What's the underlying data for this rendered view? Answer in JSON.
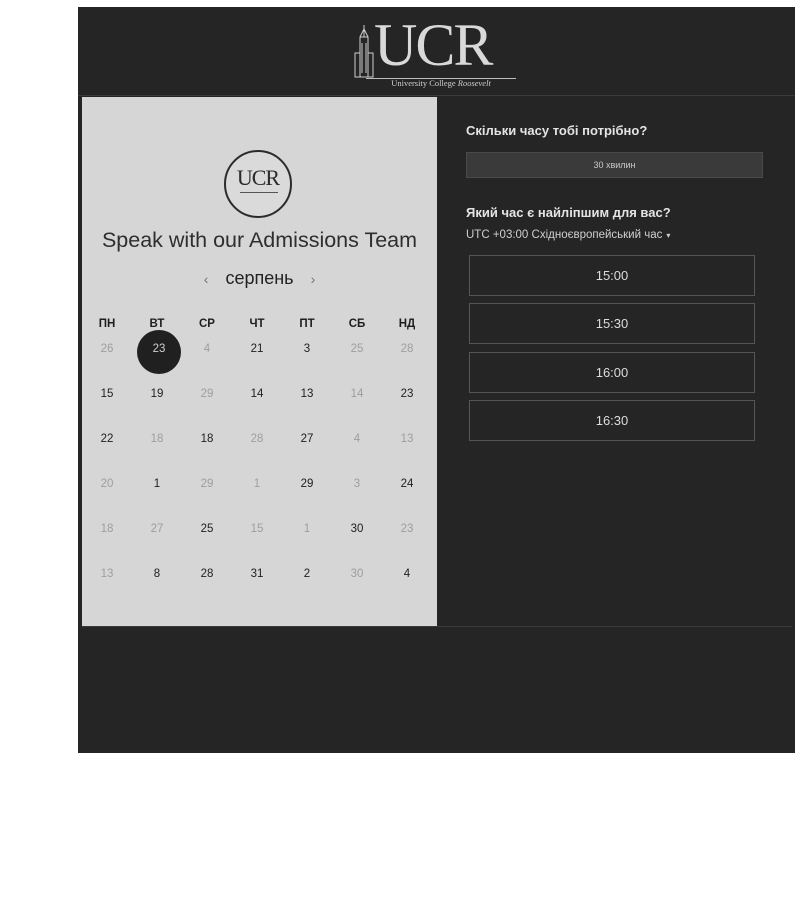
{
  "header": {
    "logo_text": "UCR",
    "logo_subtitle_main": "University College ",
    "logo_subtitle_italic": "Roosevelt"
  },
  "left": {
    "badge_text": "UCR",
    "title": "Speak with our Admissions Team",
    "month": "серпень",
    "prev_icon": "‹",
    "next_icon": "›",
    "weekdays": [
      "ПН",
      "ВТ",
      "СР",
      "ЧТ",
      "ПТ",
      "СБ",
      "НД"
    ],
    "selected_day": "23",
    "weeks": [
      [
        {
          "d": "26",
          "dim": true
        },
        {
          "d": "",
          "dim": false
        },
        {
          "d": "4",
          "dim": true
        },
        {
          "d": "21",
          "dim": false
        },
        {
          "d": "3",
          "dim": false
        },
        {
          "d": "25",
          "dim": true
        },
        {
          "d": "28",
          "dim": true
        }
      ],
      [
        {
          "d": "15",
          "dim": false
        },
        {
          "d": "19",
          "dim": false
        },
        {
          "d": "29",
          "dim": true
        },
        {
          "d": "14",
          "dim": false
        },
        {
          "d": "13",
          "dim": false
        },
        {
          "d": "14",
          "dim": true
        },
        {
          "d": "23",
          "dim": false
        }
      ],
      [
        {
          "d": "22",
          "dim": false
        },
        {
          "d": "18",
          "dim": true
        },
        {
          "d": "18",
          "dim": false
        },
        {
          "d": "28",
          "dim": true
        },
        {
          "d": "27",
          "dim": false
        },
        {
          "d": "4",
          "dim": true
        },
        {
          "d": "13",
          "dim": true
        }
      ],
      [
        {
          "d": "20",
          "dim": true
        },
        {
          "d": "1",
          "dim": false
        },
        {
          "d": "29",
          "dim": true
        },
        {
          "d": "1",
          "dim": true
        },
        {
          "d": "29",
          "dim": false
        },
        {
          "d": "3",
          "dim": true
        },
        {
          "d": "24",
          "dim": false
        }
      ],
      [
        {
          "d": "18",
          "dim": true
        },
        {
          "d": "27",
          "dim": true
        },
        {
          "d": "25",
          "dim": false
        },
        {
          "d": "15",
          "dim": true
        },
        {
          "d": "1",
          "dim": true
        },
        {
          "d": "30",
          "dim": false
        },
        {
          "d": "23",
          "dim": true
        }
      ],
      [
        {
          "d": "13",
          "dim": true
        },
        {
          "d": "8",
          "dim": false
        },
        {
          "d": "28",
          "dim": false
        },
        {
          "d": "31",
          "dim": false
        },
        {
          "d": "2",
          "dim": false
        },
        {
          "d": "30",
          "dim": true
        },
        {
          "d": "4",
          "dim": false
        }
      ]
    ]
  },
  "right": {
    "duration_question": "Скільки часу тобі потрібно?",
    "duration_value": "30 хвилин",
    "time_question": "Який час є найліпшим для вас?",
    "timezone": "UTC +03:00 Східноєвропейський час",
    "timezone_caret": "▾",
    "slots": [
      "15:00",
      "15:30",
      "16:00",
      "16:30"
    ]
  },
  "colors": {
    "frame_bg": "#252525",
    "calendar_bg": "#d6d6d6",
    "selected_day_bg": "#202020"
  }
}
